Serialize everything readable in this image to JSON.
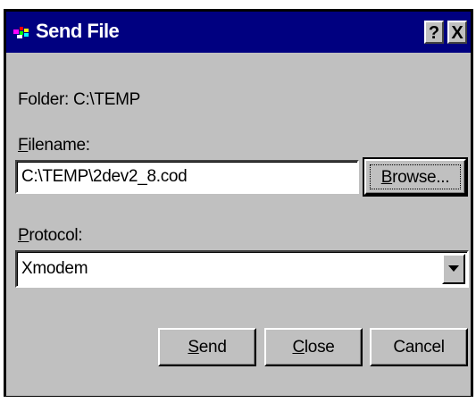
{
  "window": {
    "title": "Send File",
    "help_button": "?",
    "close_button": "X"
  },
  "icons": {
    "app": "app-icon",
    "dropdown": "chevron-down-icon"
  },
  "folder": {
    "prefix": "Folder:",
    "path": "C:\\TEMP"
  },
  "filename": {
    "label_accel": "F",
    "label_rest": "ilename:",
    "value": "C:\\TEMP\\2dev2_8.cod"
  },
  "browse": {
    "label_accel": "B",
    "label_rest": "rowse..."
  },
  "protocol": {
    "label_accel": "P",
    "label_rest": "rotocol:",
    "selected": "Xmodem"
  },
  "buttons": {
    "send_accel": "S",
    "send_rest": "end",
    "close_accel": "C",
    "close_rest": "lose",
    "cancel": "Cancel"
  },
  "colors": {
    "titlebar": "#000080",
    "dialog_face": "#c0c0c0"
  }
}
